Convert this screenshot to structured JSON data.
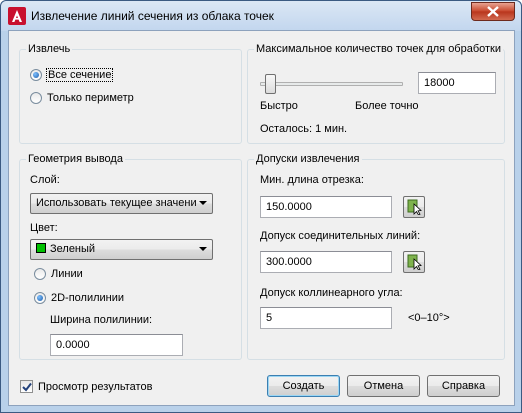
{
  "window": {
    "title": "Извлечение линий сечения из облака точек"
  },
  "extract": {
    "group_label": "Извлечь",
    "options": [
      {
        "label": "Все сечение",
        "selected": true
      },
      {
        "label": "Только периметр",
        "selected": false
      }
    ]
  },
  "max_points": {
    "group_label": "Максимальное количество точек для обработки",
    "value": "18000",
    "slider_min_label": "Быстро",
    "slider_max_label": "Более точно",
    "remaining": "Осталось: 1 мин."
  },
  "output_geometry": {
    "group_label": "Геометрия вывода",
    "layer_label": "Слой:",
    "layer_value": "Использовать текущее значени",
    "color_label": "Цвет:",
    "color_value": "Зеленый",
    "color_swatch": "#00c000",
    "types": [
      {
        "label": "Линии",
        "selected": false
      },
      {
        "label": "2D-полилинии",
        "selected": true
      }
    ],
    "width_label": "Ширина полилинии:",
    "width_value": "0.0000"
  },
  "tolerances": {
    "group_label": "Допуски извлечения",
    "min_length_label": "Мин. длина отрезка:",
    "min_length_value": "150.0000",
    "join_tol_label": "Допуск соединительных линий:",
    "join_tol_value": "300.0000",
    "collinear_label": "Допуск коллинеарного угла:",
    "collinear_value": "5",
    "collinear_range": "<0–10°>"
  },
  "preview": {
    "label": "Просмотр результатов",
    "checked": true
  },
  "buttons": {
    "create": "Создать",
    "cancel": "Отмена",
    "help": "Справка"
  }
}
